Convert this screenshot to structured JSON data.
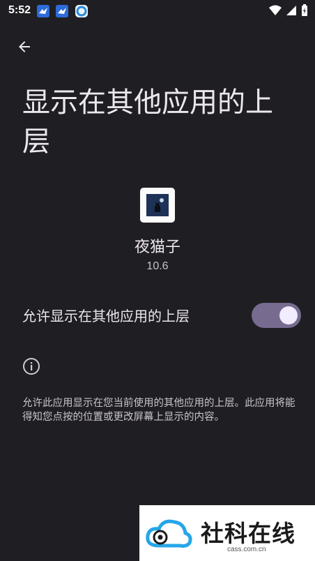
{
  "status_bar": {
    "time": "5:52"
  },
  "header": {
    "title": "显示在其他应用的上层"
  },
  "app": {
    "name": "夜猫子",
    "version": "10.6"
  },
  "permission": {
    "label": "允许显示在其他应用的上层",
    "enabled": true
  },
  "info": {
    "text": "允许此应用显示在您当前使用的其他应用的上层。此应用将能得知您点按的位置或更改屏幕上显示的内容。"
  },
  "watermark": {
    "name": "社科在线",
    "domain": "cass.com.cn"
  },
  "colors": {
    "background": "#1f1e22",
    "toggle_track": "#776b8f",
    "toggle_thumb": "#f2ecff"
  }
}
